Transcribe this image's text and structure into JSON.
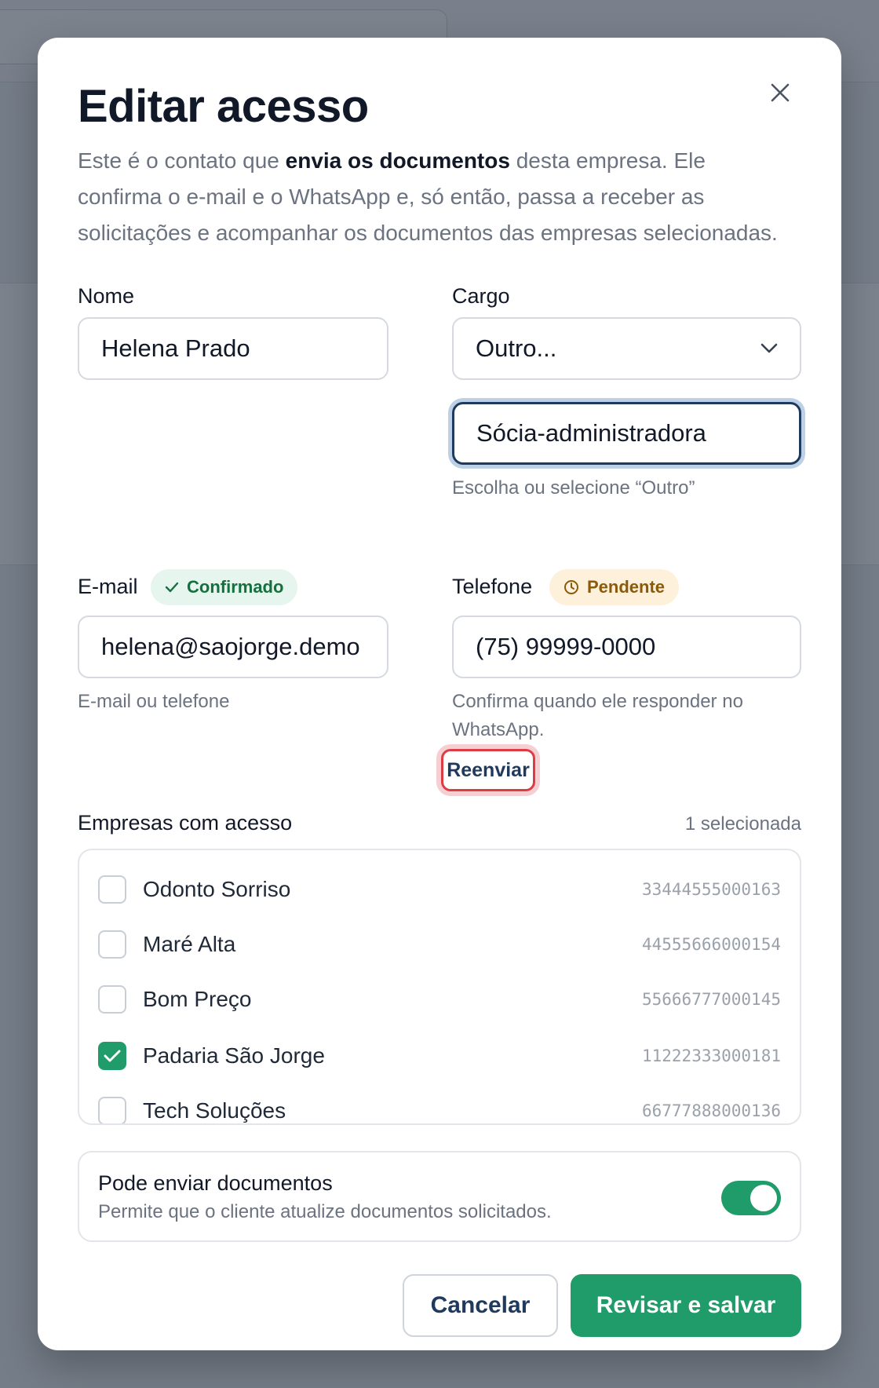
{
  "modal": {
    "title": "Editar acesso",
    "description_prefix": "Este é o contato que ",
    "description_bold": "envia os documentos",
    "description_suffix": " desta empresa. Ele confirma o e-mail e o WhatsApp e, só então, passa a receber as solicitações e acompanhar os documentos das empresas selecionadas."
  },
  "form": {
    "name_label": "Nome",
    "name_value": "Helena Prado",
    "role_label": "Cargo",
    "role_selected": "Outro...",
    "role_custom_value": "Sócia-administradora",
    "role_hint": "Escolha ou selecione “Outro”",
    "email_label": "E-mail",
    "email_badge": "Confirmado",
    "email_value": "helena@saojorge.demo",
    "email_hint": "E-mail ou telefone",
    "phone_label": "Telefone",
    "phone_badge": "Pendente",
    "phone_value": "(75) 99999-0000",
    "phone_hint": "Confirma quando ele responder no WhatsApp.",
    "resend_label": "Reenviar"
  },
  "companies": {
    "label": "Empresas com acesso",
    "count_text": "1 selecionada",
    "items": [
      {
        "name": "Odonto Sorriso",
        "id": "33444555000163",
        "checked": false
      },
      {
        "name": "Maré Alta",
        "id": "44555666000154",
        "checked": false
      },
      {
        "name": "Bom Preço",
        "id": "55666777000145",
        "checked": false
      },
      {
        "name": "Padaria São Jorge",
        "id": "11222333000181",
        "checked": true
      },
      {
        "name": "Tech Soluções",
        "id": "66777888000136",
        "checked": false
      }
    ]
  },
  "permission": {
    "title": "Pode enviar documentos",
    "description": "Permite que o cliente atualize documentos solicitados.",
    "enabled": true
  },
  "actions": {
    "cancel_label": "Cancelar",
    "save_label": "Revisar e salvar"
  },
  "colors": {
    "primary_green": "#1f9c6a",
    "navy": "#1f3a5c",
    "focus_ring": "#bcd0e6",
    "highlight_red": "#dc3d45"
  },
  "icons": {
    "close": "close-icon",
    "dropdown": "chevron-down-icon",
    "confirmed": "check-icon",
    "pending": "clock-icon",
    "checkbox_checked": "check-icon"
  }
}
